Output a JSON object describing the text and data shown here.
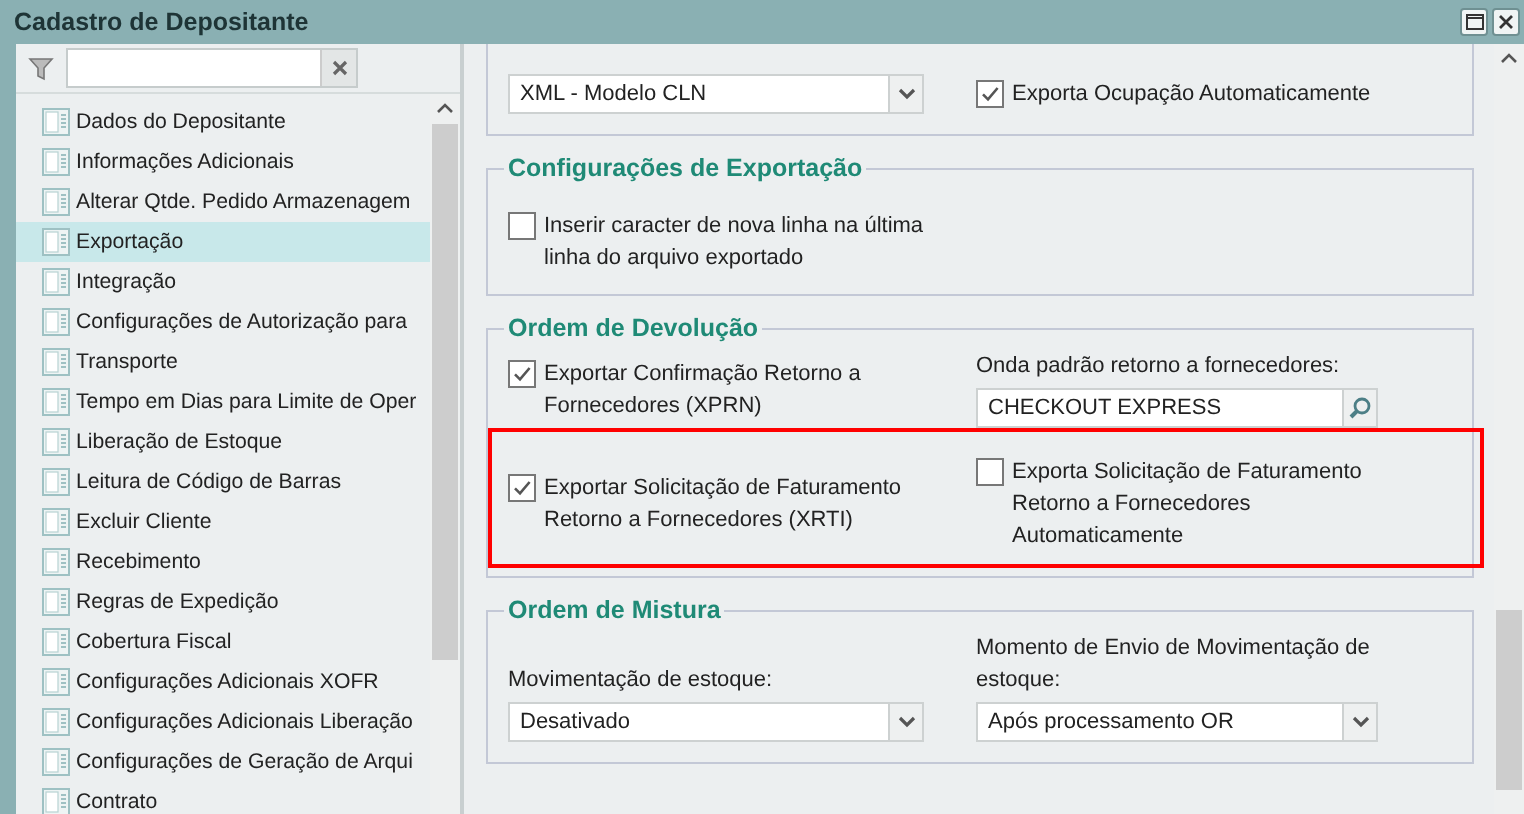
{
  "window": {
    "title": "Cadastro de Depositante"
  },
  "sidebar": {
    "items": [
      {
        "label": "Dados do Depositante",
        "selected": false
      },
      {
        "label": "Informações Adicionais",
        "selected": false
      },
      {
        "label": "Alterar Qtde. Pedido Armazenagem",
        "selected": false
      },
      {
        "label": "Exportação",
        "selected": true
      },
      {
        "label": "Integração",
        "selected": false
      },
      {
        "label": "Configurações de Autorização para",
        "selected": false
      },
      {
        "label": "Transporte",
        "selected": false
      },
      {
        "label": "Tempo em Dias para Limite de Oper",
        "selected": false
      },
      {
        "label": "Liberação de Estoque",
        "selected": false
      },
      {
        "label": "Leitura de Código de Barras",
        "selected": false
      },
      {
        "label": "Excluir Cliente",
        "selected": false
      },
      {
        "label": "Recebimento",
        "selected": false
      },
      {
        "label": "Regras de Expedição",
        "selected": false
      },
      {
        "label": "Cobertura Fiscal",
        "selected": false
      },
      {
        "label": "Configurações Adicionais XOFR",
        "selected": false
      },
      {
        "label": "Configurações Adicionais Liberação",
        "selected": false
      },
      {
        "label": "Configurações de Geração de Arqui",
        "selected": false
      },
      {
        "label": "Contrato",
        "selected": false
      }
    ]
  },
  "form": {
    "sections": [
      {
        "rows": [
          {
            "highlighted": false,
            "cells": [
              {
                "kind": "select",
                "value": "XML - Modelo CLN"
              },
              {
                "kind": "checkbox",
                "label": "Exporta Ocupação Automaticamente",
                "checked": true
              }
            ]
          }
        ]
      },
      {
        "legend": "Configurações de Exportação",
        "rows": [
          {
            "highlighted": false,
            "cells": [
              {
                "kind": "checkbox",
                "label": "Inserir caracter de nova linha na última linha do arquivo exportado",
                "checked": false
              }
            ]
          }
        ]
      },
      {
        "legend": "Ordem de Devolução",
        "rows": [
          {
            "highlighted": false,
            "cells": [
              {
                "kind": "checkbox",
                "label": "Exportar Confirmação Retorno a Fornecedores (XPRN)",
                "checked": true
              },
              {
                "kind": "lookup",
                "label": "Onda padrão retorno a fornecedores:",
                "value": "CHECKOUT EXPRESS"
              }
            ]
          },
          {
            "highlighted": true,
            "cells": [
              {
                "kind": "checkbox",
                "label": "Exportar Solicitação de Faturamento Retorno a Fornecedores (XRTI)",
                "checked": true
              },
              {
                "kind": "checkbox",
                "label": "Exporta Solicitação de Faturamento Retorno a Fornecedores Automaticamente",
                "checked": false
              }
            ]
          }
        ]
      },
      {
        "legend": "Ordem de Mistura",
        "rows": [
          {
            "highlighted": false,
            "cells": [
              {
                "kind": "select",
                "label": "Movimentação de estoque:",
                "value": "Desativado"
              },
              {
                "kind": "select",
                "label": "Momento de Envio de Movimentação de estoque:",
                "value": "Após processamento OR"
              }
            ]
          }
        ]
      }
    ]
  }
}
